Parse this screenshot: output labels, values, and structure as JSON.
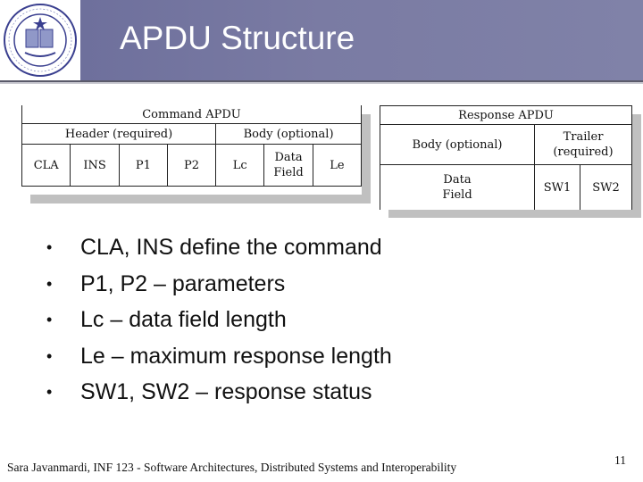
{
  "slide": {
    "title": "APDU Structure",
    "logo": "university-of-california-irvine-seal",
    "logo_text": {
      "top": "THE UNIVERSITY OF CALIFORNIA",
      "bottom": "IRVINE"
    },
    "colors": {
      "header": "#7a7ba3",
      "shadow": "#c0c0c0",
      "text": "#111111"
    }
  },
  "command_apdu": {
    "title": "Command APDU",
    "groups": [
      {
        "label": "Header (required)"
      },
      {
        "label": "Body (optional)"
      }
    ],
    "fields": [
      "CLA",
      "INS",
      "P1",
      "P2",
      "Lc",
      "Data\nField",
      "Le"
    ],
    "field_lines": {
      "data_field_1": "Data",
      "data_field_2": "Field"
    }
  },
  "response_apdu": {
    "title": "Response APDU",
    "groups": [
      {
        "label": "Body (optional)"
      },
      {
        "label_1": "Trailer",
        "label_2": "(required)"
      }
    ],
    "fields": {
      "data_1": "Data",
      "data_2": "Field",
      "sw1": "SW1",
      "sw2": "SW2"
    }
  },
  "bullets": [
    "CLA, INS define the command",
    "P1, P2 – parameters",
    "Lc – data field length",
    "Le – maximum response length",
    "SW1, SW2 – response status"
  ],
  "bullet_glyph": "•",
  "footer": {
    "text": "Sara Javanmardi, INF 123 - Software Architectures, Distributed Systems and Interoperability",
    "page_number": "11"
  }
}
